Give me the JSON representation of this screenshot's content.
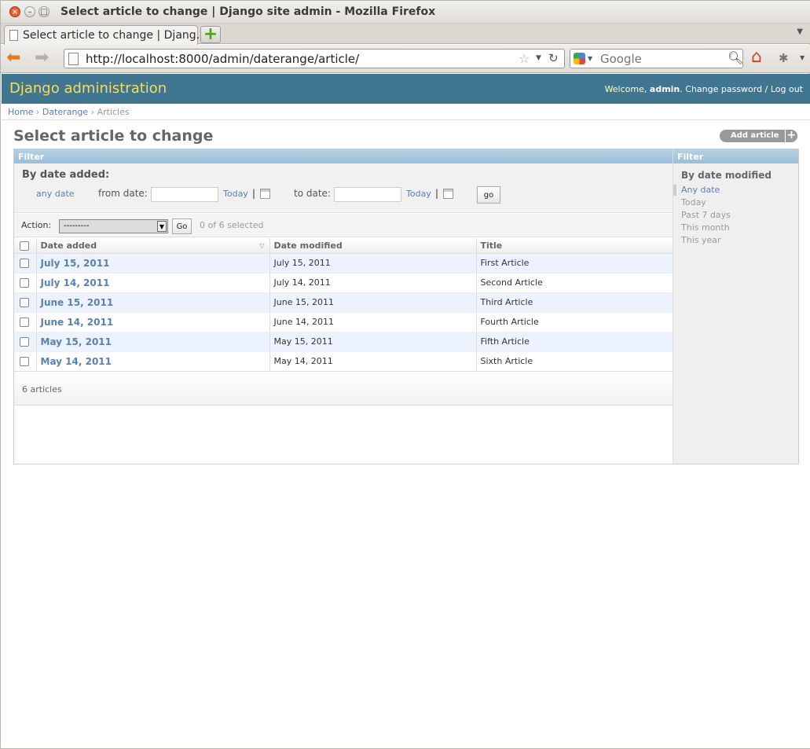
{
  "browser": {
    "window_title": "Select article to change | Django site admin - Mozilla Firefox",
    "tab_title": "Select article to change | Djang…",
    "url": "http://localhost:8000/admin/daterange/article/",
    "search_placeholder": "Google"
  },
  "admin": {
    "branding": "Django administration",
    "welcome": "Welcome,",
    "username": "admin",
    "change_password": "Change password",
    "separator": "/",
    "logout": "Log out",
    "breadcrumbs": [
      "Home",
      "Daterange",
      "Articles"
    ],
    "breadcrumb_sep": "›"
  },
  "page": {
    "title": "Select article to change",
    "add_button": "Add article"
  },
  "date_filter": {
    "header": "Filter",
    "title": "By date added:",
    "any_date": "any date",
    "from_label": "from date:",
    "to_label": "to date:",
    "today": "Today",
    "sep": "|",
    "go": "go"
  },
  "actions": {
    "label": "Action:",
    "selected_option": "---------",
    "go": "Go",
    "counter": "0 of 6 selected"
  },
  "table": {
    "columns": [
      "Date added",
      "Date modified",
      "Title"
    ],
    "rows": [
      {
        "added": "July 15, 2011",
        "modified": "July 15, 2011",
        "title": "First Article"
      },
      {
        "added": "July 14, 2011",
        "modified": "July 14, 2011",
        "title": "Second Article"
      },
      {
        "added": "June 15, 2011",
        "modified": "June 15, 2011",
        "title": "Third Article"
      },
      {
        "added": "June 14, 2011",
        "modified": "June 14, 2011",
        "title": "Fourth Article"
      },
      {
        "added": "May 15, 2011",
        "modified": "May 15, 2011",
        "title": "Fifth Article"
      },
      {
        "added": "May 14, 2011",
        "modified": "May 14, 2011",
        "title": "Sixth Article"
      }
    ],
    "count": "6 articles"
  },
  "sidebar_filter": {
    "header": "Filter",
    "title": "By date modified",
    "options": [
      "Any date",
      "Today",
      "Past 7 days",
      "This month",
      "This year"
    ],
    "selected_index": 0
  },
  "colors": {
    "header_bg": "#417690",
    "branding": "#f5dd5d",
    "link": "#5b80b2",
    "row_alt": "#edf3fe"
  }
}
